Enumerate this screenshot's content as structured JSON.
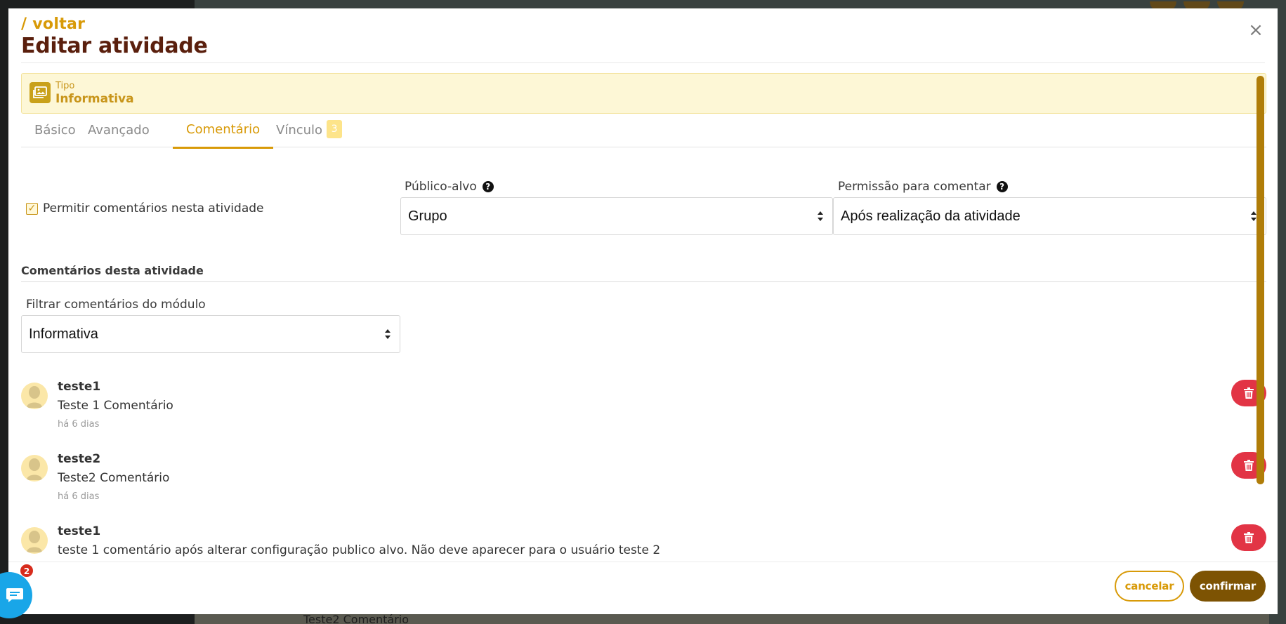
{
  "background": {
    "comment_text": "Teste2 Comentário"
  },
  "header": {
    "back_label": "/ voltar",
    "title": "Editar atividade",
    "close_symbol": "×"
  },
  "type_banner": {
    "label": "Tipo",
    "value": "Informativa",
    "icon": "image-icon"
  },
  "tabs": [
    {
      "label": "Básico",
      "active": false
    },
    {
      "label": "Avançado",
      "active": false
    },
    {
      "label": "Comentário",
      "active": true
    },
    {
      "label": "Vínculo",
      "active": false,
      "badge": "3"
    }
  ],
  "settings": {
    "allow_comments_label": "Permitir comentários nesta atividade",
    "allow_comments_checked": true,
    "audience_label": "Público-alvo",
    "audience_value": "Grupo",
    "permission_label": "Permissão para comentar",
    "permission_value": "Após realização da atividade"
  },
  "comments_section": {
    "title": "Comentários desta atividade",
    "filter_label": "Filtrar comentários do módulo",
    "filter_value": "Informativa"
  },
  "comments": [
    {
      "author": "teste1",
      "text": "Teste 1 Comentário",
      "time": "há 6 dias"
    },
    {
      "author": "teste2",
      "text": "Teste2 Comentário",
      "time": "há 6 dias"
    },
    {
      "author": "teste1",
      "text": "teste 1 comentário após alterar configuração publico alvo. Não deve aparecer para o usuário teste 2",
      "time": ""
    }
  ],
  "footer": {
    "cancel_label": "cancelar",
    "confirm_label": "confirmar"
  },
  "chat_widget": {
    "badge_count": "2",
    "icon": "chat-icon"
  },
  "colors": {
    "accent": "#d89a08",
    "title": "#5a1f0d",
    "confirm": "#7d5303",
    "delete": "#e23445",
    "banner_bg": "#fdf7d6"
  }
}
